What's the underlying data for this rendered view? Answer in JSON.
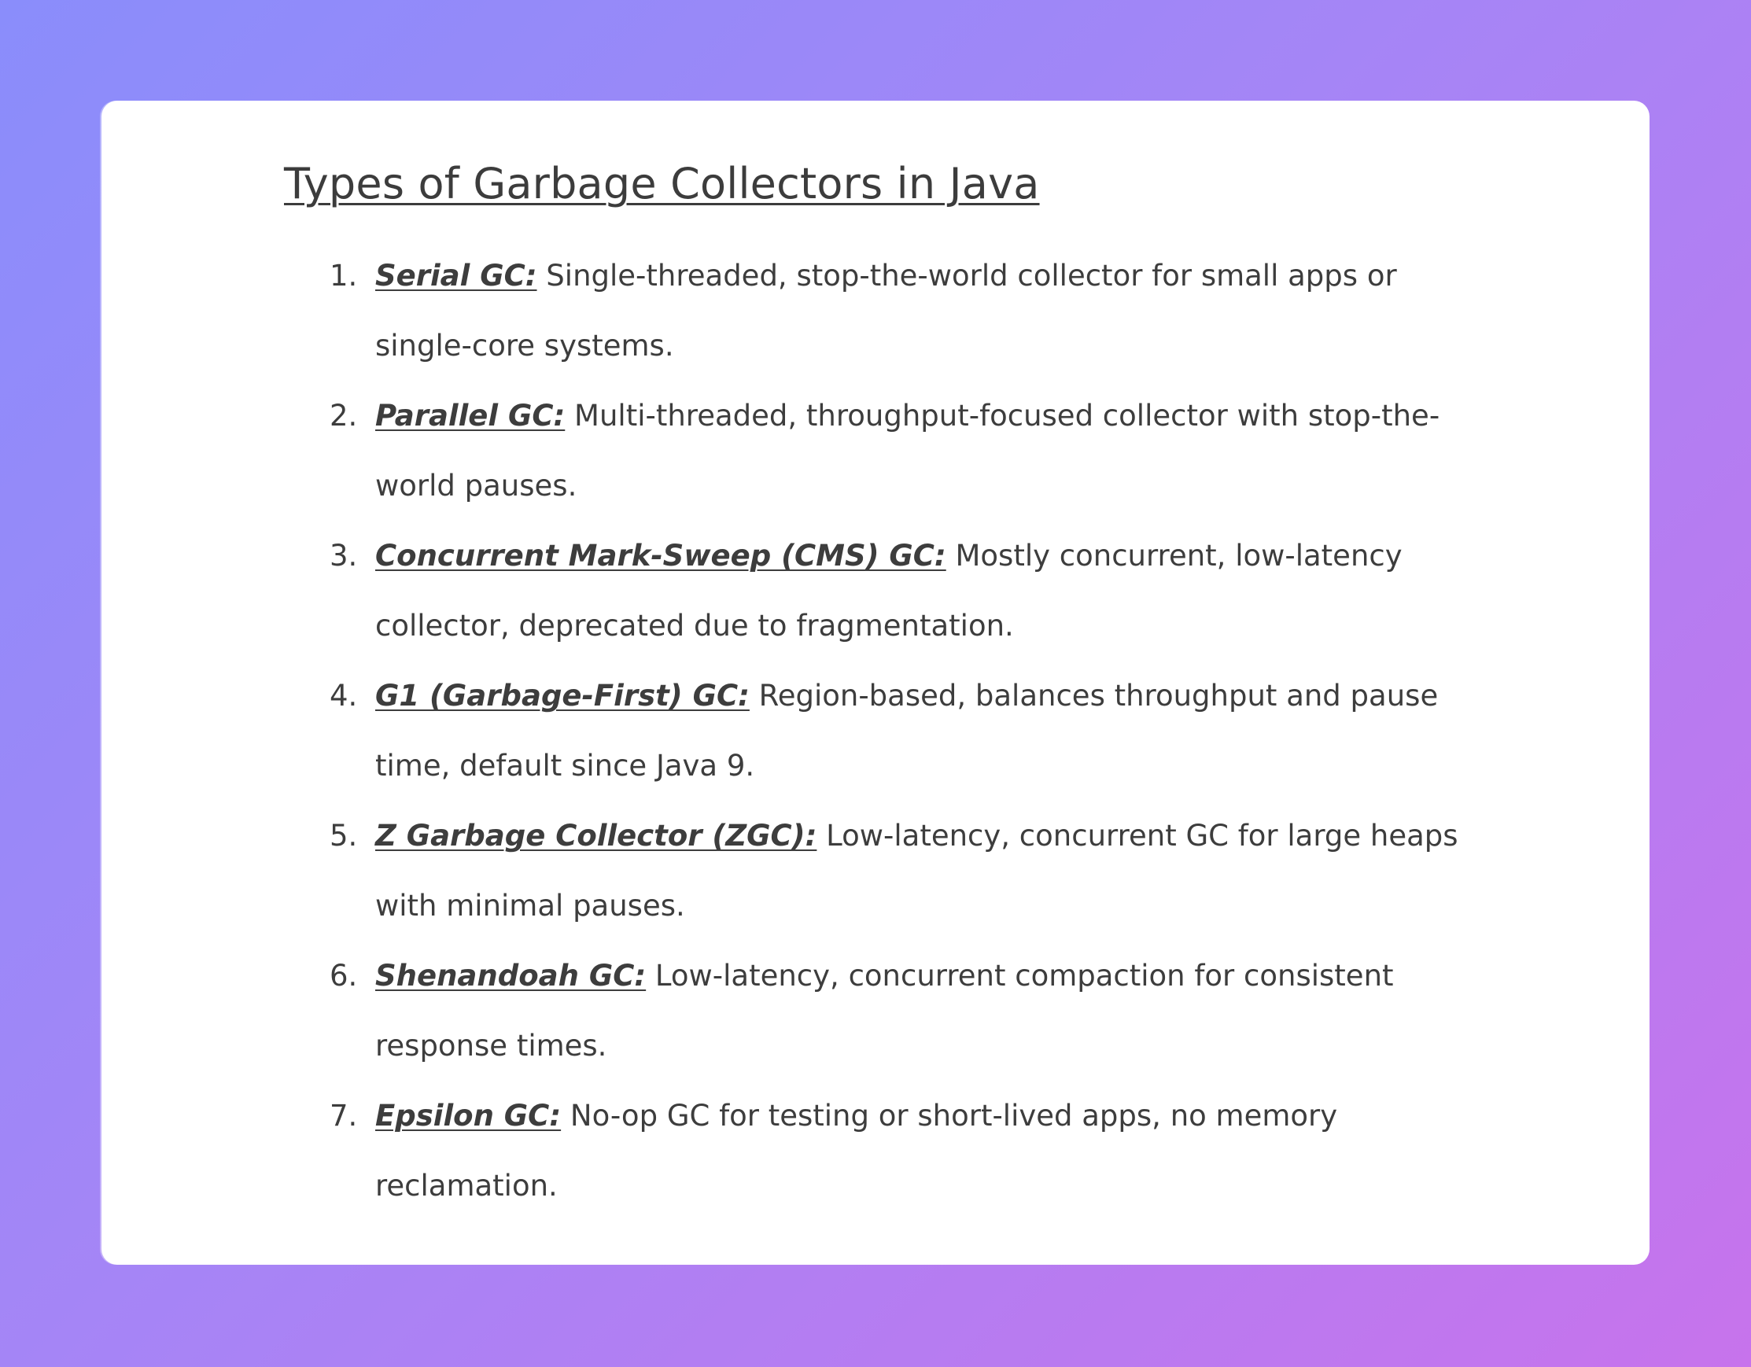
{
  "page": {
    "title": "Types of Garbage Collectors in Java"
  },
  "items": [
    {
      "number": "1.",
      "name": "Serial GC:",
      "description": "Single-threaded, stop-the-world collector for small apps or single-core systems."
    },
    {
      "number": "2.",
      "name": "Parallel GC:",
      "description": "Multi-threaded, throughput-focused collector with stop-the-world pauses."
    },
    {
      "number": "3.",
      "name": "Concurrent Mark-Sweep (CMS) GC:",
      "description": "Mostly concurrent, low-latency collector, deprecated due to fragmentation."
    },
    {
      "number": "4.",
      "name": "G1 (Garbage-First) GC:",
      "description": "Region-based, balances throughput and pause time, default since Java 9."
    },
    {
      "number": "5.",
      "name": "Z Garbage Collector (ZGC):",
      "description": "Low-latency, concurrent GC for large heaps with minimal pauses."
    },
    {
      "number": "6.",
      "name": "Shenandoah GC:",
      "description": "Low-latency, concurrent compaction for consistent response times."
    },
    {
      "number": "7.",
      "name": "Epsilon GC:",
      "description": "No-op GC for testing or short-lived apps, no memory reclamation."
    }
  ],
  "colors": {
    "text": "#3d3d3d",
    "card": "#ffffff",
    "gradient_start": "#8a8dfb",
    "gradient_end": "#c773ec"
  }
}
